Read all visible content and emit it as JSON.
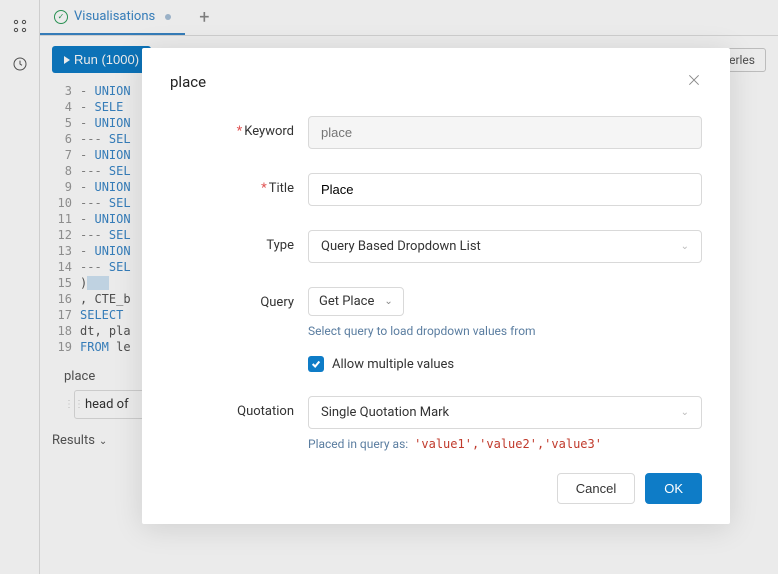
{
  "tabs": {
    "active": "Visualisations"
  },
  "toolbar": {
    "run": "Run (1000)",
    "serverless": "Serverles"
  },
  "editor": {
    "lines": [
      {
        "n": 3,
        "text": "- UNION"
      },
      {
        "n": 4,
        "text": "- SELE"
      },
      {
        "n": 5,
        "text": "- UNION"
      },
      {
        "n": 6,
        "text": "--- SEL"
      },
      {
        "n": 7,
        "text": "- UNION"
      },
      {
        "n": 8,
        "text": "--- SEL"
      },
      {
        "n": 9,
        "text": "- UNION"
      },
      {
        "n": 10,
        "text": "--- SEL"
      },
      {
        "n": 11,
        "text": "- UNION"
      },
      {
        "n": 12,
        "text": "--- SEL"
      },
      {
        "n": 13,
        "text": "- UNION"
      },
      {
        "n": 14,
        "text": "--- SEL"
      },
      {
        "n": 15,
        "text": ")"
      },
      {
        "n": 16,
        "text": ", CTE_b"
      },
      {
        "n": 17,
        "text": "SELECT"
      },
      {
        "n": 18,
        "text": "dt, pla"
      },
      {
        "n": 19,
        "text": "FROM le"
      }
    ]
  },
  "param": {
    "label": "place",
    "value": "head of"
  },
  "bottom": {
    "results": "Results"
  },
  "modal": {
    "title": "place",
    "labels": {
      "keyword": "Keyword",
      "title": "Title",
      "type": "Type",
      "query": "Query",
      "quotation": "Quotation"
    },
    "keyword_placeholder": "place",
    "title_value": "Place",
    "type_value": "Query Based Dropdown List",
    "query_value": "Get Place",
    "query_hint": "Select query to load dropdown values from",
    "allow_multi": "Allow multiple values",
    "quotation_value": "Single Quotation Mark",
    "example_prefix": "Placed in query as:",
    "example_code": "'value1','value2','value3'",
    "cancel": "Cancel",
    "ok": "OK"
  }
}
